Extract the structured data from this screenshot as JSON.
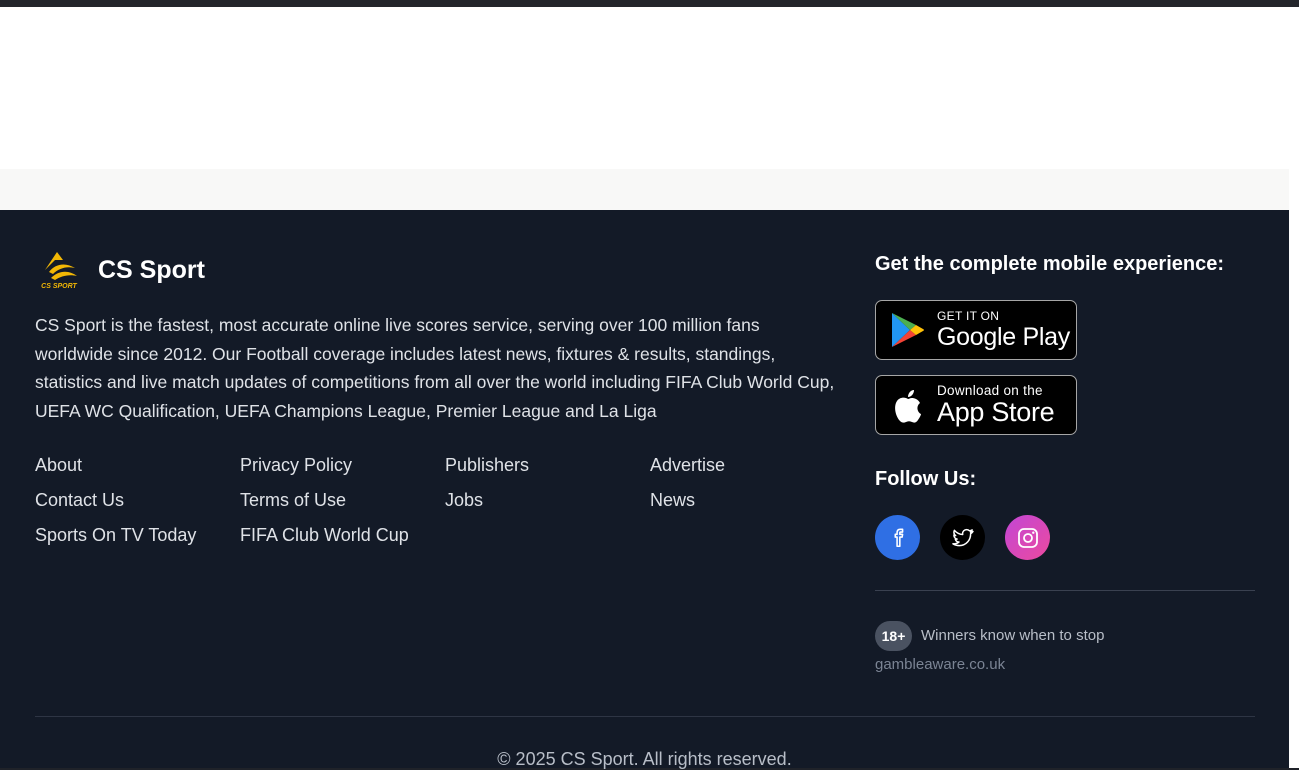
{
  "brand": {
    "name": "CS Sport",
    "logo_text": "CS SPORT"
  },
  "about_text": "CS Sport is the fastest, most accurate online live scores service, serving over 100 million fans worldwide since 2012. Our Football coverage includes latest news, fixtures & results, standings, statistics and live match updates of competitions from all over the world including FIFA Club World Cup, UEFA WC Qualification, UEFA Champions League, Premier League and La Liga",
  "links": {
    "about": "About",
    "contact": "Contact Us",
    "sports_tv": "Sports On TV Today",
    "privacy": "Privacy Policy",
    "terms": "Terms of Use",
    "fifa_cwc": "FIFA Club World Cup",
    "publishers": "Publishers",
    "jobs": "Jobs",
    "advertise": "Advertise",
    "news": "News"
  },
  "mobile": {
    "title": "Get the complete mobile experience:",
    "google_play": {
      "small": "GET IT ON",
      "big": "Google Play"
    },
    "app_store": {
      "small": "Download on the",
      "big": "App Store"
    }
  },
  "follow": {
    "title": "Follow Us:",
    "icons": [
      "facebook-icon",
      "twitter-icon",
      "instagram-icon"
    ]
  },
  "responsible": {
    "badge": "18+",
    "message": "Winners know when to stop",
    "site": "gambleaware.co.uk"
  },
  "copyright": "© 2025 CS Sport. All rights reserved.",
  "colors": {
    "footer_bg": "#131a27",
    "logo_gold": "#f2b705",
    "facebook": "#2f6fe4",
    "instagram_start": "#c246d6",
    "instagram_end": "#ec4a9e"
  }
}
